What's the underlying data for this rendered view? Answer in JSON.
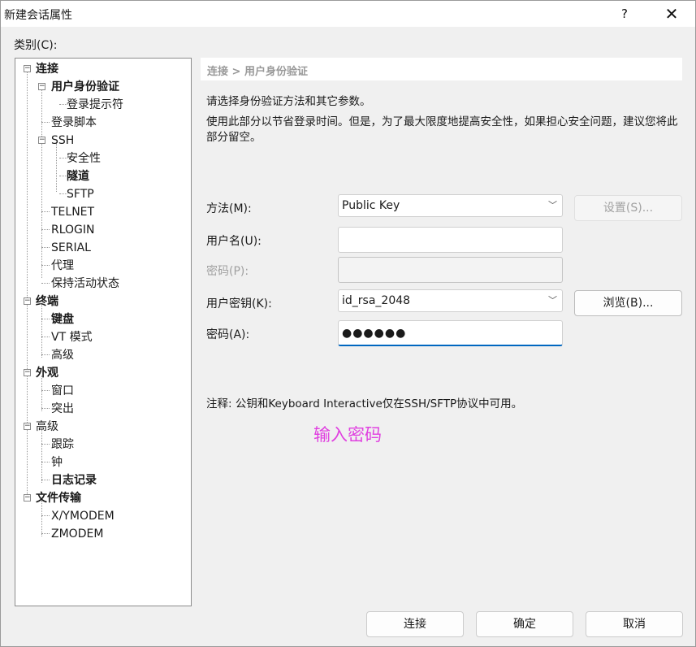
{
  "window": {
    "title": "新建会话属性",
    "help_label": "?",
    "close_label": "✕"
  },
  "category_label": "类别(C):",
  "tree": [
    {
      "label": "连接"
    },
    {
      "label": "用户身份验证"
    },
    {
      "label": "登录提示符"
    },
    {
      "label": "登录脚本"
    },
    {
      "label": "SSH"
    },
    {
      "label": "安全性"
    },
    {
      "label": "隧道"
    },
    {
      "label": "SFTP"
    },
    {
      "label": "TELNET"
    },
    {
      "label": "RLOGIN"
    },
    {
      "label": "SERIAL"
    },
    {
      "label": "代理"
    },
    {
      "label": "保持活动状态"
    },
    {
      "label": "终端"
    },
    {
      "label": "键盘"
    },
    {
      "label": "VT 模式"
    },
    {
      "label": "高级"
    },
    {
      "label": "外观"
    },
    {
      "label": "窗口"
    },
    {
      "label": "突出"
    },
    {
      "label": "高级"
    },
    {
      "label": "跟踪"
    },
    {
      "label": "钟"
    },
    {
      "label": "日志记录"
    },
    {
      "label": "文件传输"
    },
    {
      "label": "X/YMODEM"
    },
    {
      "label": "ZMODEM"
    }
  ],
  "panel": {
    "breadcrumb": "连接 > 用户身份验证",
    "description1": "请选择身份验证方法和其它参数。",
    "description2": "使用此部分以节省登录时间。但是，为了最大限度地提高安全性，如果担心安全问题，建议您将此部分留空。",
    "method_label": "方法(M):",
    "method_value": "Public Key",
    "settings_button": "设置(S)...",
    "username_label": "用户名(U):",
    "username_value": "",
    "password_label": "密码(P):",
    "password_value": "",
    "user_key_label": "用户密钥(K):",
    "user_key_value": "id_rsa_2048",
    "browse_button": "浏览(B)...",
    "passphrase_label": "密码(A):",
    "passphrase_value": "●●●●●●",
    "note": "注释: 公钥和Keyboard Interactive仅在SSH/SFTP协议中可用。",
    "hint": "输入密码"
  },
  "footer": {
    "connect_button": "连接",
    "ok_button": "确定",
    "cancel_button": "取消"
  },
  "colors": {
    "window_bg": "#f0f0f0",
    "accent": "#0067c0",
    "hint": "#e040e0",
    "breadcrumb": "#999999"
  }
}
